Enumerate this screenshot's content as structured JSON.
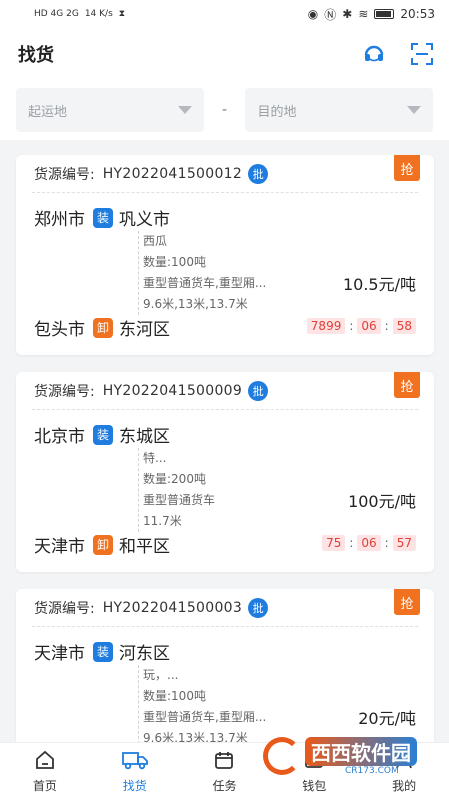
{
  "status": {
    "left_text": "HD 4G 2G",
    "speed": "14 K/s",
    "time": "20:53"
  },
  "header": {
    "title": "找货"
  },
  "filters": {
    "origin_placeholder": "起运地",
    "separator": "-",
    "dest_placeholder": "目的地"
  },
  "cards": [
    {
      "grab": "抢",
      "label": "货源编号:",
      "code": "HY2022041500012",
      "pi": "批",
      "from_city": "郑州市",
      "load": "装",
      "from_district": "巩义市",
      "goods": "西瓜",
      "qty": "数量:100吨",
      "truck": "重型普通货车,重型厢...",
      "length": "9.6米,13米,13.7米",
      "price": "10.5元/吨",
      "to_city": "包头市",
      "unload": "卸",
      "to_district": "东河区",
      "timer": [
        "7899",
        "06",
        "58"
      ]
    },
    {
      "grab": "抢",
      "label": "货源编号:",
      "code": "HY2022041500009",
      "pi": "批",
      "from_city": "北京市",
      "load": "装",
      "from_district": "东城区",
      "goods": "特...",
      "qty": "数量:200吨",
      "truck": "重型普通货车",
      "length": "11.7米",
      "price": "100元/吨",
      "to_city": "天津市",
      "unload": "卸",
      "to_district": "和平区",
      "timer": [
        "75",
        "06",
        "57"
      ]
    },
    {
      "grab": "抢",
      "label": "货源编号:",
      "code": "HY2022041500003",
      "pi": "批",
      "from_city": "天津市",
      "load": "装",
      "from_district": "河东区",
      "goods": "玩，...",
      "qty": "数量:100吨",
      "truck": "重型普通货车,重型厢...",
      "length": "9.6米,13米,13.7米",
      "price": "20元/吨"
    }
  ],
  "tabs": [
    {
      "label": "首页"
    },
    {
      "label": "找货"
    },
    {
      "label": "任务"
    },
    {
      "label": "钱包"
    },
    {
      "label": "我的"
    }
  ],
  "watermark": {
    "main": "西西软件园",
    "sub": "CR173.COM"
  },
  "colors": {
    "accent": "#1f7de0",
    "orange": "#f0711f",
    "timer": "#e0403a"
  }
}
